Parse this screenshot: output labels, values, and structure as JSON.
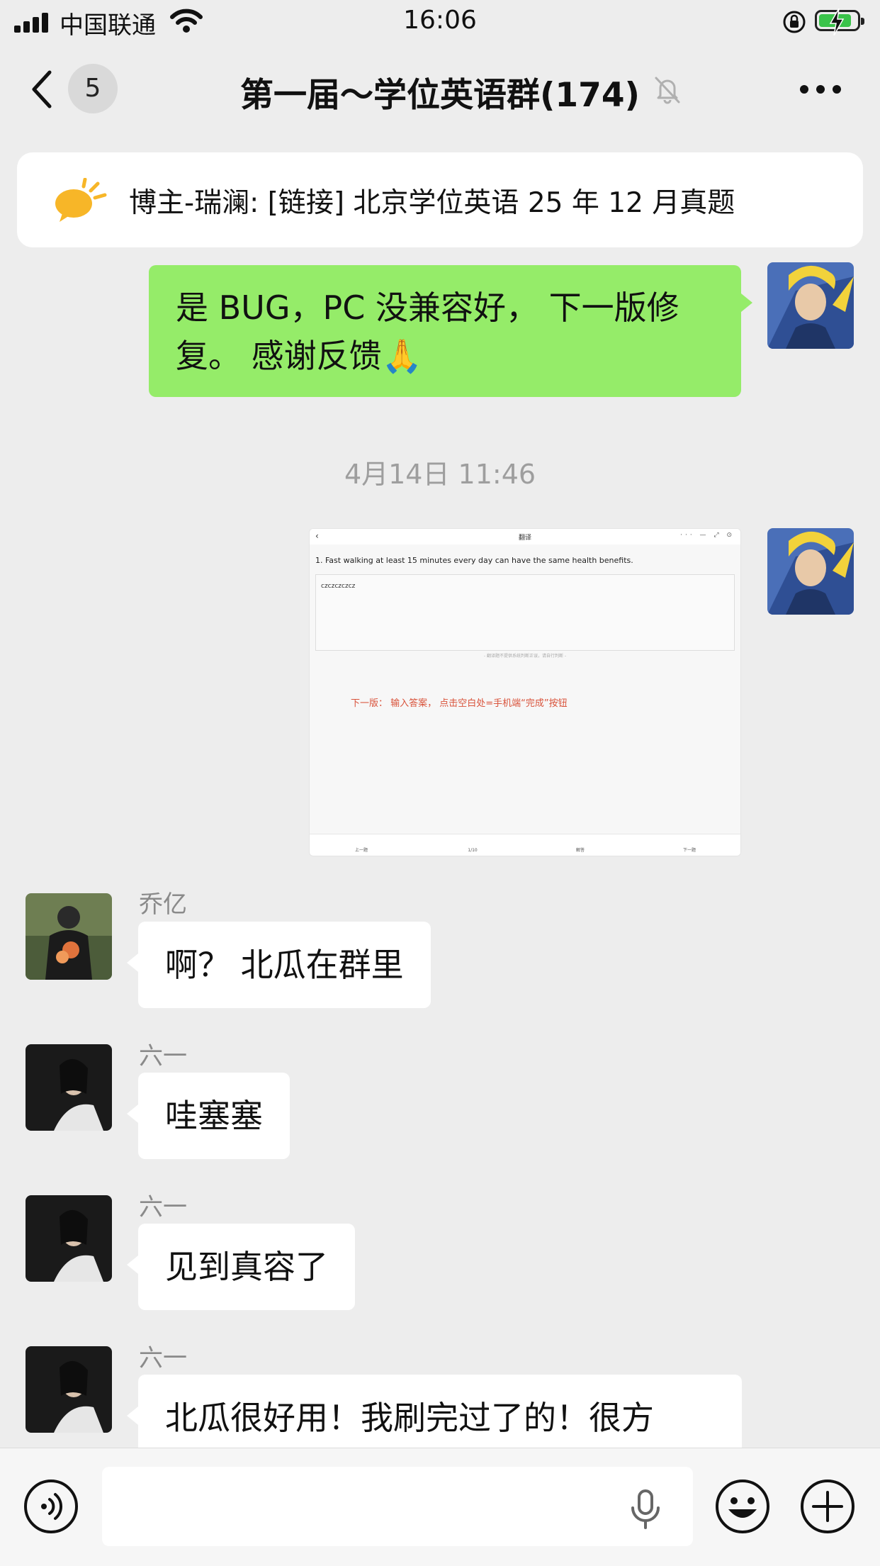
{
  "status_bar": {
    "carrier": "中国联通",
    "time": "16:06"
  },
  "nav": {
    "unread_count": "5",
    "title": "第一届～学位英语群(174)"
  },
  "pinned": {
    "text": "博主-瑞澜: [链接] 北京学位英语 25 年 12 月真题"
  },
  "messages": [
    {
      "type": "text",
      "from_self": true,
      "lines": [
        "是 BUG，PC 没兼容好， 下一版修",
        "复。 感谢反馈🙏"
      ]
    },
    {
      "type": "timestamp",
      "text": "4月14日 11:46"
    },
    {
      "type": "image",
      "from_self": true,
      "image": {
        "title": "翻译",
        "question": "1. Fast walking at least 15 minutes every day can have the same health benefits.",
        "answer": "czczczczcz",
        "hint": "- 翻译题不提供系统判断正误，请自行判断 -",
        "note": "下一版： 输入答案， 点击空白处=手机端“完成”按钮",
        "bottom_items": [
          "上一题",
          "1/10",
          "解答",
          "下一题"
        ]
      }
    },
    {
      "type": "text",
      "sender": "乔亿",
      "text": "啊？ 北瓜在群里"
    },
    {
      "type": "text",
      "sender": "六一",
      "text": "哇塞塞"
    },
    {
      "type": "text",
      "sender": "六一",
      "text": "见到真容了"
    },
    {
      "type": "text",
      "sender": "六一",
      "text": "北瓜很好用！我刷完过了的！很方"
    }
  ],
  "colors": {
    "self_bubble": "#95ec69",
    "other_bubble": "#ffffff",
    "background": "#ededed"
  }
}
